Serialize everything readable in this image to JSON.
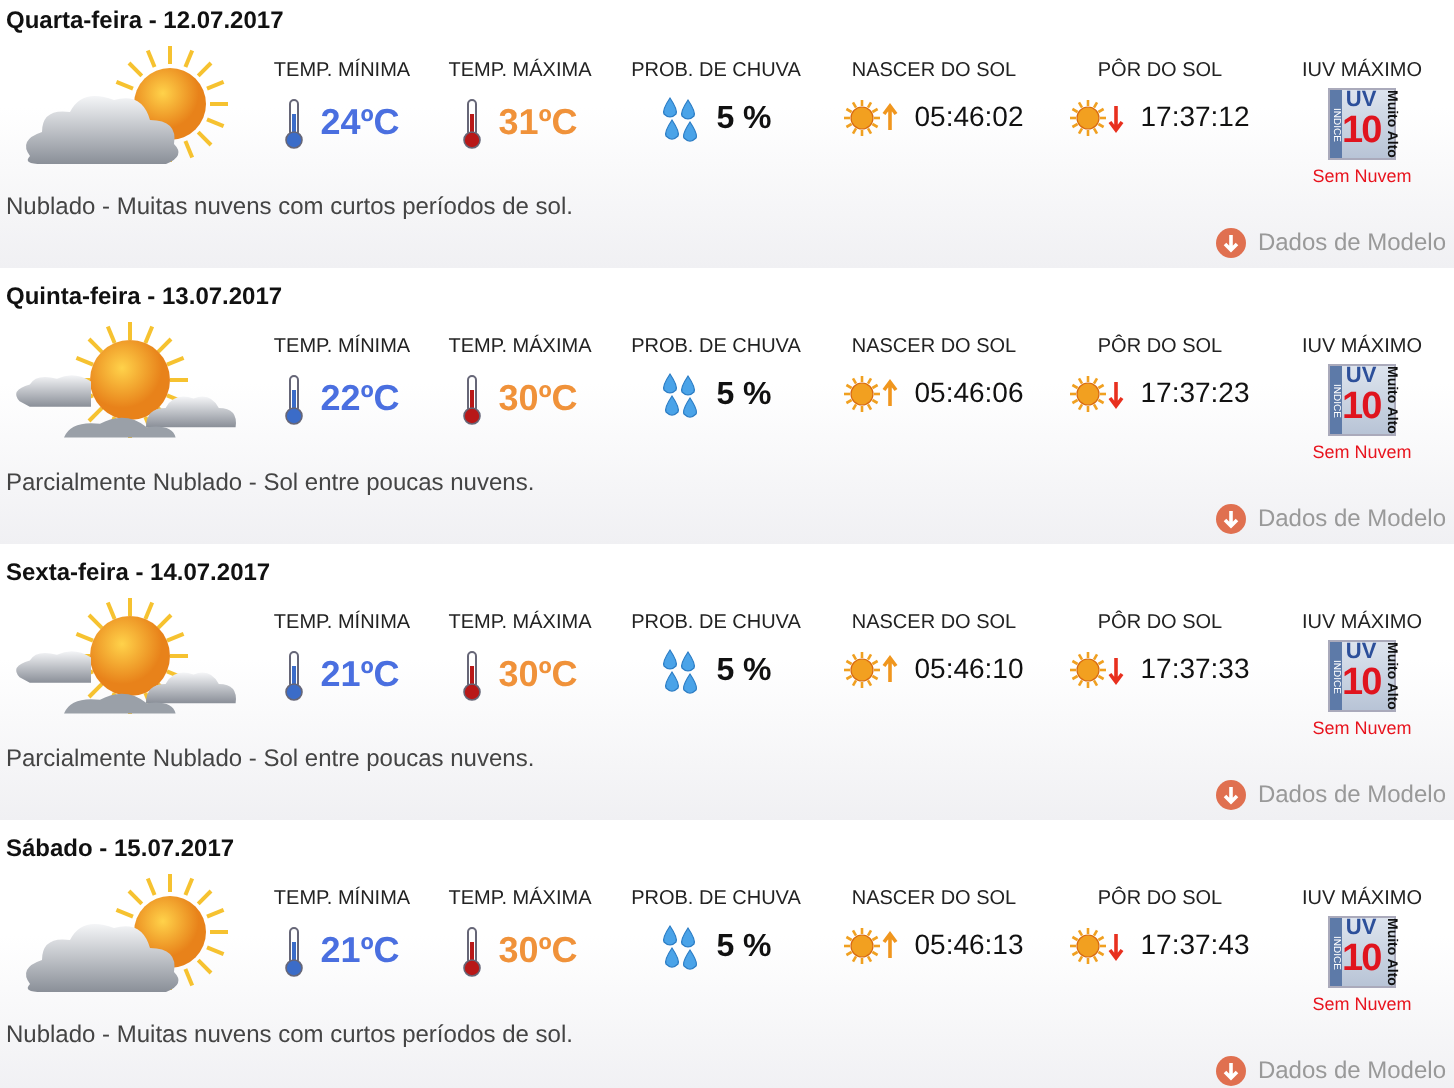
{
  "days": [
    {
      "title": "Quarta-feira - 12.07.2017",
      "kind": "cloudy",
      "min_label": "TEMP. MÍNIMA",
      "min": "24ºC",
      "max_label": "TEMP. MÁXIMA",
      "max": "31ºC",
      "rain_label": "PROB. DE CHUVA",
      "rain": "5 %",
      "sunrise_label": "NASCER DO SOL",
      "sunrise": "05:46:02",
      "sunset_label": "PÔR DO SOL",
      "sunset": "17:37:12",
      "uv_label": "IUV MÁXIMO",
      "uv_badge": {
        "index_word": "INDICE",
        "uv": "UV",
        "value": "10",
        "level": "Muito Alto"
      },
      "uv_note": "Sem Nuvem",
      "description": "Nublado - Muitas nuvens com curtos períodos de sol.",
      "model_link": "Dados de Modelo"
    },
    {
      "title": "Quinta-feira - 13.07.2017",
      "kind": "partly",
      "min_label": "TEMP. MÍNIMA",
      "min": "22ºC",
      "max_label": "TEMP. MÁXIMA",
      "max": "30ºC",
      "rain_label": "PROB. DE CHUVA",
      "rain": "5 %",
      "sunrise_label": "NASCER DO SOL",
      "sunrise": "05:46:06",
      "sunset_label": "PÔR DO SOL",
      "sunset": "17:37:23",
      "uv_label": "IUV MÁXIMO",
      "uv_badge": {
        "index_word": "INDICE",
        "uv": "UV",
        "value": "10",
        "level": "Muito Alto"
      },
      "uv_note": "Sem Nuvem",
      "description": "Parcialmente Nublado - Sol entre poucas nuvens.",
      "model_link": "Dados de Modelo"
    },
    {
      "title": "Sexta-feira - 14.07.2017",
      "kind": "partly",
      "min_label": "TEMP. MÍNIMA",
      "min": "21ºC",
      "max_label": "TEMP. MÁXIMA",
      "max": "30ºC",
      "rain_label": "PROB. DE CHUVA",
      "rain": "5 %",
      "sunrise_label": "NASCER DO SOL",
      "sunrise": "05:46:10",
      "sunset_label": "PÔR DO SOL",
      "sunset": "17:37:33",
      "uv_label": "IUV MÁXIMO",
      "uv_badge": {
        "index_word": "INDICE",
        "uv": "UV",
        "value": "10",
        "level": "Muito Alto"
      },
      "uv_note": "Sem Nuvem",
      "description": "Parcialmente Nublado - Sol entre poucas nuvens.",
      "model_link": "Dados de Modelo"
    },
    {
      "title": "Sábado - 15.07.2017",
      "kind": "cloudy",
      "min_label": "TEMP. MÍNIMA",
      "min": "21ºC",
      "max_label": "TEMP. MÁXIMA",
      "max": "30ºC",
      "rain_label": "PROB. DE CHUVA",
      "rain": "5 %",
      "sunrise_label": "NASCER DO SOL",
      "sunrise": "05:46:13",
      "sunset_label": "PÔR DO SOL",
      "sunset": "17:37:43",
      "uv_label": "IUV MÁXIMO",
      "uv_badge": {
        "index_word": "INDICE",
        "uv": "UV",
        "value": "10",
        "level": "Muito Alto"
      },
      "uv_note": "Sem Nuvem",
      "description": "Nublado - Muitas nuvens com curtos períodos de sol.",
      "model_link": "Dados de Modelo"
    }
  ]
}
